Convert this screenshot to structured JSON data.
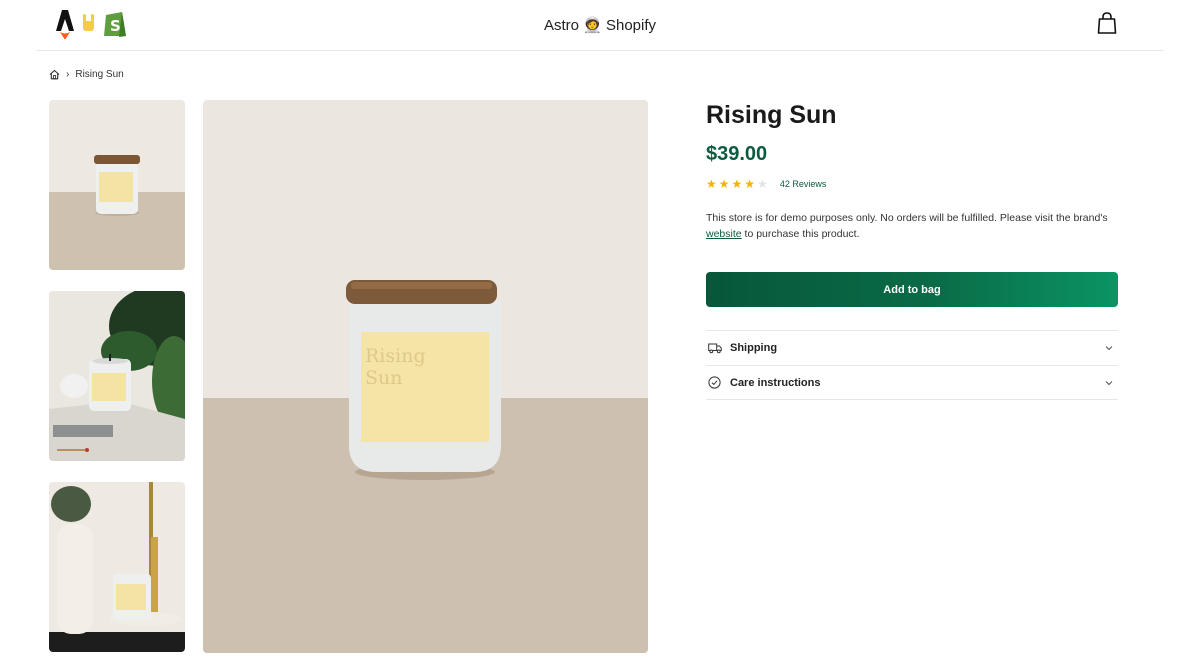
{
  "header": {
    "title": "Astro 🧑‍🚀 Shopify",
    "logo_icons": [
      "astro-logo-icon",
      "rock-hand-icon",
      "shopify-logo-icon"
    ],
    "bag_icon": "shopping-bag-icon"
  },
  "breadcrumb": {
    "home_icon": "home-icon",
    "separator": "›",
    "current": "Rising Sun"
  },
  "gallery": {
    "thumbnails": [
      "candle-on-table",
      "candle-with-plant-and-matches",
      "candle-on-tray-with-vase"
    ],
    "main_image": "rising-sun-candle"
  },
  "product": {
    "title": "Rising Sun",
    "price": "$39.00",
    "rating": 4,
    "rating_max": 5,
    "reviews_label": "42 Reviews",
    "description_before": "This store is for demo purposes only. No orders will be fulfilled. Please visit the brand's ",
    "description_link": "website",
    "description_after": " to purchase this product.",
    "add_to_bag_label": "Add to bag",
    "accordion": [
      {
        "label": "Shipping",
        "icon": "truck-icon"
      },
      {
        "label": "Care instructions",
        "icon": "check-circle-icon"
      }
    ]
  },
  "colors": {
    "brand_green": "#0d5c3d",
    "star": "#f5b400",
    "button_gradient_start": "#07573a",
    "button_gradient_end": "#0b9463"
  }
}
